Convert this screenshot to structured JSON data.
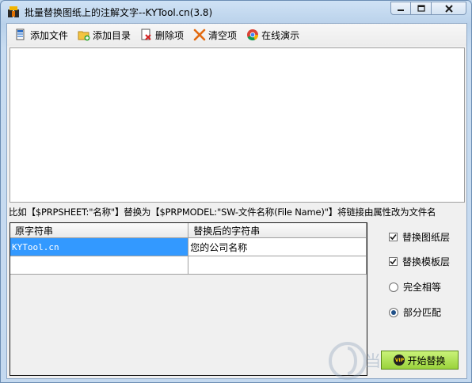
{
  "window": {
    "title": "批量替换图纸上的注解文字--KYTool.cn(3.8)"
  },
  "toolbar": {
    "items": [
      {
        "label": "添加文件",
        "icon": "add-file-icon"
      },
      {
        "label": "添加目录",
        "icon": "add-folder-icon"
      },
      {
        "label": "删除项",
        "icon": "delete-item-icon"
      },
      {
        "label": "清空项",
        "icon": "clear-icon"
      },
      {
        "label": "在线演示",
        "icon": "browser-icon"
      }
    ]
  },
  "hint": "比如【$PRPSHEET:\"名称\"】替换为【$PRPMODEL:\"SW-文件名称(File Name)\"】将链接由属性改为文件名",
  "grid": {
    "headers": [
      "原字符串",
      "替换后的字符串"
    ],
    "rows": [
      [
        "KYTool.cn",
        "您的公司名称"
      ],
      [
        "",
        ""
      ]
    ]
  },
  "options": {
    "replace_drawing_layer": {
      "label": "替换图纸层",
      "checked": true
    },
    "replace_template_layer": {
      "label": "替换模板层",
      "checked": true
    },
    "exact_match": {
      "label": "完全相等",
      "selected": false
    },
    "partial_match": {
      "label": "部分匹配",
      "selected": true
    }
  },
  "start_button": {
    "badge": "VIP",
    "label": "开始替换"
  },
  "watermark": "当下软件园",
  "colors": {
    "selection": "#3399ff",
    "start_button": "#a8dc4a",
    "title_bar": "#c4d9ef"
  }
}
